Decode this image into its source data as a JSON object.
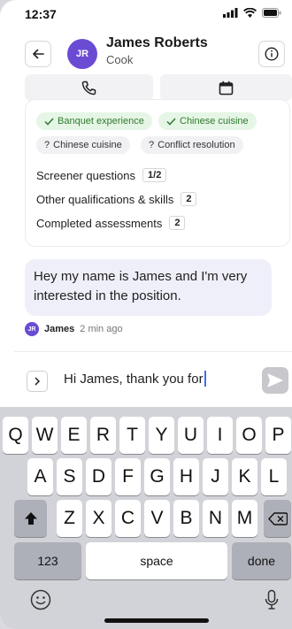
{
  "status_bar": {
    "time": "12:37"
  },
  "header": {
    "back_icon": "back-arrow-icon",
    "avatar_initials": "JR",
    "name": "James Roberts",
    "role": "Cook",
    "info_icon": "info-icon",
    "actions": [
      {
        "icon": "phone-icon"
      },
      {
        "icon": "calendar-icon"
      }
    ]
  },
  "profile_card": {
    "matched_skills": [
      "Banquet experience",
      "Chinese cuisine"
    ],
    "unmatched_skills": [
      "Chinese cuisine",
      "Conflict resolution"
    ],
    "stats": [
      {
        "label": "Screener questions",
        "value": "1/2"
      },
      {
        "label": "Other qualifications & skills",
        "value": "2"
      },
      {
        "label": "Completed assessments",
        "value": "2"
      }
    ]
  },
  "message": {
    "text": "Hey my name is James and I'm very interested in the position.",
    "sender_initials": "JR",
    "sender": "James",
    "time": "2 min ago"
  },
  "composer": {
    "value": "Hi James, thank you for",
    "send_icon": "send-icon"
  },
  "keyboard": {
    "row1": [
      "Q",
      "W",
      "E",
      "R",
      "T",
      "Y",
      "U",
      "I",
      "O",
      "P"
    ],
    "row2": [
      "A",
      "S",
      "D",
      "F",
      "G",
      "H",
      "J",
      "K",
      "L"
    ],
    "row3": [
      "Z",
      "X",
      "C",
      "V",
      "B",
      "N",
      "M"
    ],
    "numbers_key": "123",
    "space_key": "space",
    "done_key": "done"
  },
  "colors": {
    "accent": "#6a4bd4",
    "matched_bg": "#e6f6e6",
    "bubble_bg": "#efeffa"
  }
}
